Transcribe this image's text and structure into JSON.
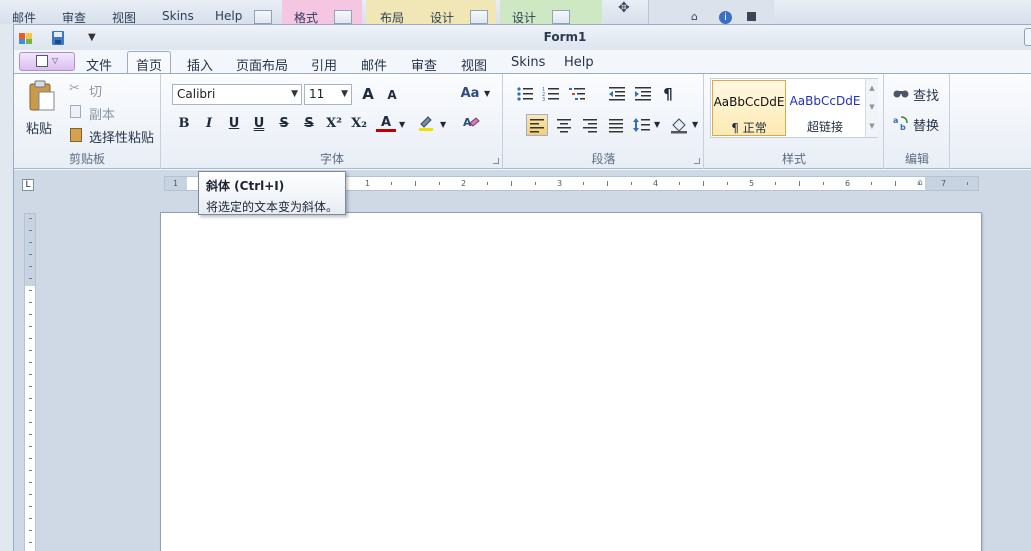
{
  "background_app": {
    "tabs": [
      "邮件",
      "审查",
      "视图",
      "Skins",
      "Help"
    ],
    "context_tabs": [
      {
        "label": "格式",
        "color": "#f4c6e2"
      },
      {
        "label": "布局",
        "color": "#f1e7b6"
      },
      {
        "label": "设计",
        "color": "#f1e7b6"
      },
      {
        "label": "设计",
        "color": "#cfe8c4"
      }
    ]
  },
  "window": {
    "title": "Form1"
  },
  "quick_access": {
    "icons": [
      "app-logo-icon",
      "save-icon",
      "customize-dropdown-icon"
    ]
  },
  "tabs": [
    "文件",
    "首页",
    "插入",
    "页面布局",
    "引用",
    "邮件",
    "审查",
    "视图",
    "Skins",
    "Help"
  ],
  "active_tab": "首页",
  "ribbon": {
    "clipboard": {
      "label": "剪贴板",
      "paste": "粘贴",
      "cut": "切",
      "copy": "副本",
      "paste_special": "选择性粘贴"
    },
    "font": {
      "label": "字体",
      "font_name": "Calibri",
      "font_size": "11",
      "grow_glyph": "A",
      "shrink_glyph": "A",
      "change_case_glyph": "Aa",
      "bold_glyph": "B",
      "italic_glyph": "I",
      "underline_glyph": "U",
      "double_underline_glyph": "U",
      "strike_glyph": "S",
      "double_strike_glyph": "S",
      "superscript_glyph": "X²",
      "subscript_glyph": "X₂",
      "font_color_glyph": "A",
      "font_color": "#c00000",
      "highlight_color": "#f0e000"
    },
    "paragraph": {
      "label": "段落",
      "show_marks_glyph": "¶"
    },
    "styles": {
      "label": "样式",
      "items": [
        {
          "preview": "AaBbCcDdE",
          "name": "¶ 正常"
        },
        {
          "preview": "AaBbCcDdE",
          "name": "超链接"
        }
      ]
    },
    "editing": {
      "label": "编辑",
      "find": "查找",
      "replace": "替换"
    }
  },
  "ruler": {
    "corner_glyph": "L",
    "numbers": [
      "1",
      "1",
      "2",
      "3",
      "4",
      "5",
      "6",
      "7"
    ]
  },
  "tooltip": {
    "title": "斜体 (Ctrl+I)",
    "description": "将选定的文本变为斜体。"
  }
}
